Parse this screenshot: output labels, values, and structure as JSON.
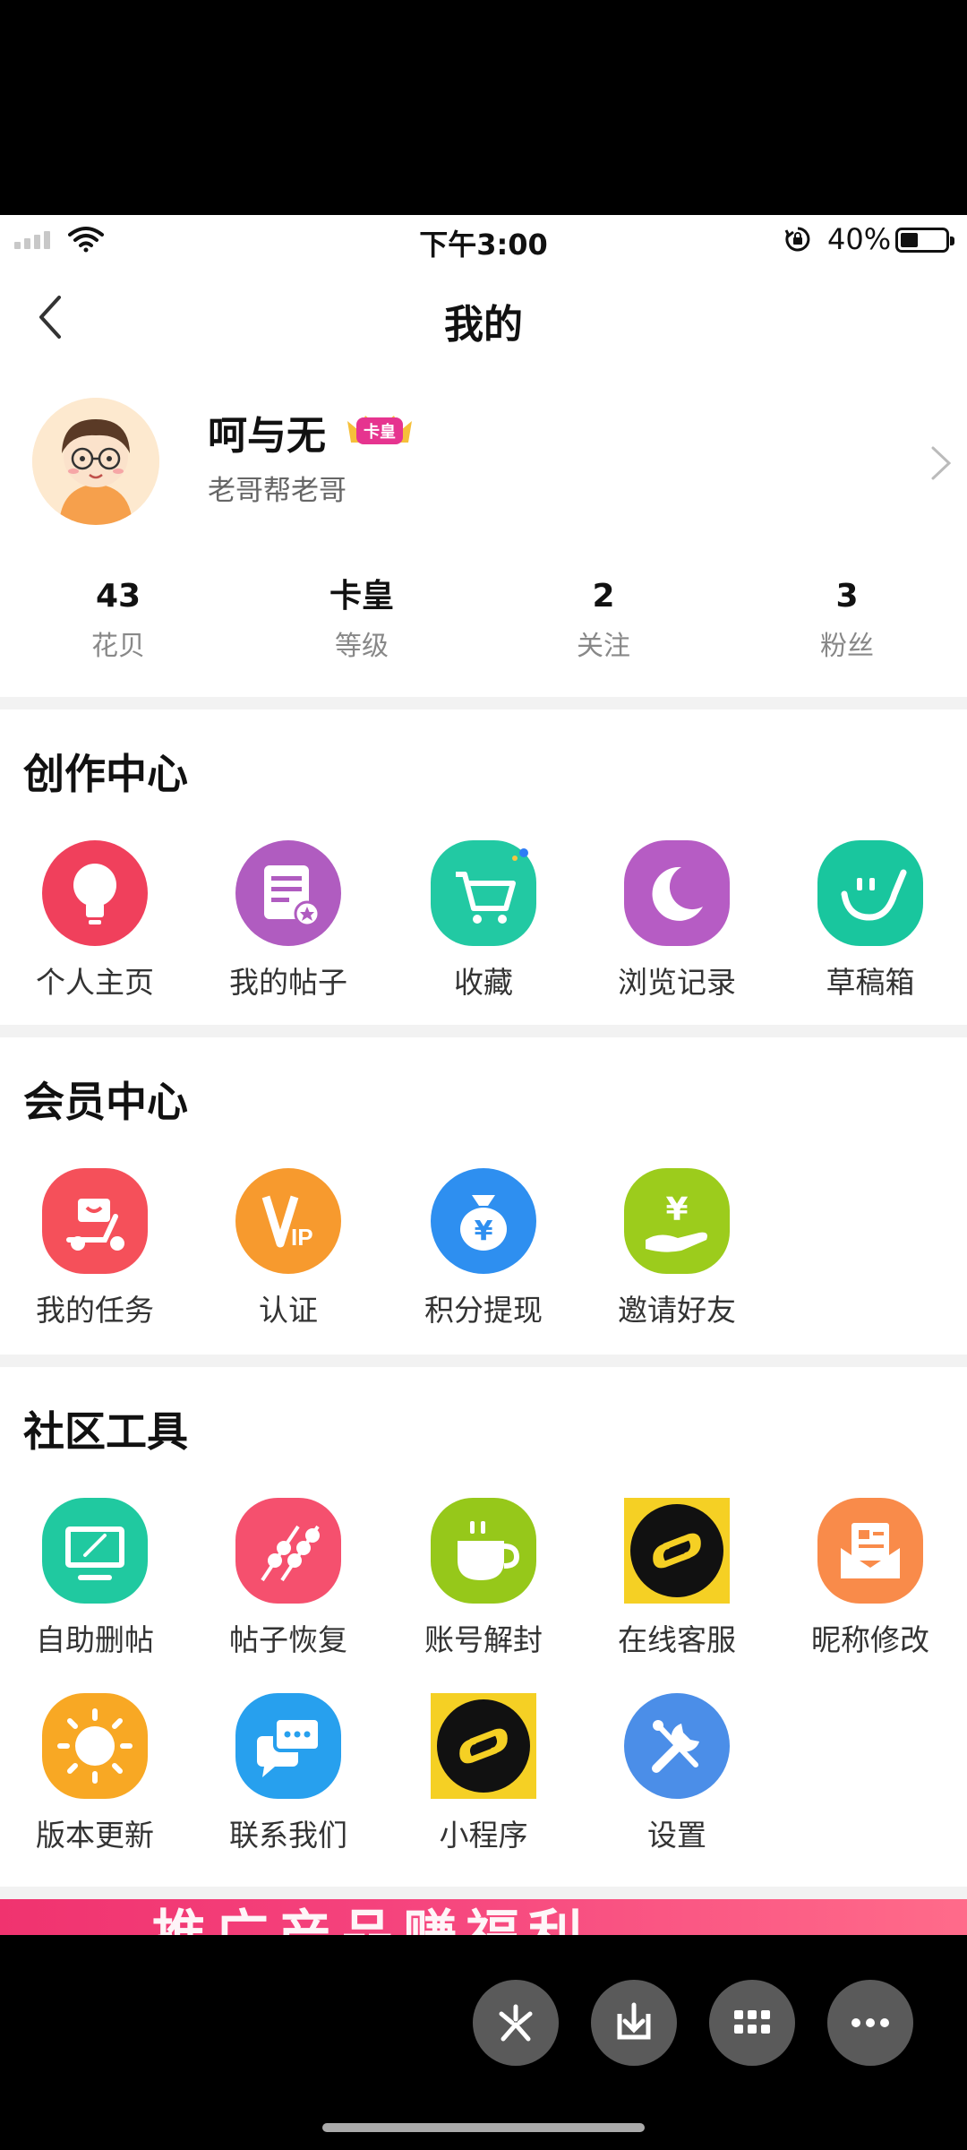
{
  "status_bar": {
    "time": "下午3:00",
    "battery_percent": "40%",
    "battery_level": 0.4
  },
  "nav": {
    "title": "我的"
  },
  "profile": {
    "name": "呵与无",
    "badge": "卡皇",
    "bio": "老哥帮老哥"
  },
  "stats": [
    {
      "value": "43",
      "label": "花贝"
    },
    {
      "value": "卡皇",
      "label": "等级"
    },
    {
      "value": "2",
      "label": "关注"
    },
    {
      "value": "3",
      "label": "粉丝"
    }
  ],
  "creation": {
    "title": "创作中心",
    "items": [
      {
        "label": "个人主页",
        "icon": "lightbulb-icon",
        "color": "#f0405c"
      },
      {
        "label": "我的帖子",
        "icon": "document-icon",
        "color": "#b05cc0"
      },
      {
        "label": "收藏",
        "icon": "cart-icon",
        "color": "#22c9a3"
      },
      {
        "label": "浏览记录",
        "icon": "moon-icon",
        "color": "#b65cc4"
      },
      {
        "label": "草稿箱",
        "icon": "draft-icon",
        "color": "#19c69e"
      }
    ]
  },
  "member": {
    "title": "会员中心",
    "items": [
      {
        "label": "我的任务",
        "icon": "scooter-icon",
        "color": "#f5505a"
      },
      {
        "label": "认证",
        "icon": "vip-icon",
        "color": "#f79a2e"
      },
      {
        "label": "积分提现",
        "icon": "money-bag-icon",
        "color": "#2e8ff0"
      },
      {
        "label": "邀请好友",
        "icon": "yen-hand-icon",
        "color": "#9ccc1c"
      }
    ]
  },
  "tools": {
    "title": "社区工具",
    "items": [
      {
        "label": "自助删帖",
        "icon": "monitor-pen-icon",
        "color": "#20c9a0"
      },
      {
        "label": "帖子恢复",
        "icon": "skewer-icon",
        "color": "#f5506e"
      },
      {
        "label": "账号解封",
        "icon": "cup-icon",
        "color": "#96c81a"
      },
      {
        "label": "在线客服",
        "icon": "mini-program-icon",
        "color": "#f5d024"
      },
      {
        "label": "昵称修改",
        "icon": "mail-icon",
        "color": "#f98b4a"
      },
      {
        "label": "版本更新",
        "icon": "sun-icon",
        "color": "#f8a824"
      },
      {
        "label": "联系我们",
        "icon": "chat-icon",
        "color": "#27a0ee"
      },
      {
        "label": "小程序",
        "icon": "mini-program-icon",
        "color": "#f5d024"
      },
      {
        "label": "设置",
        "icon": "wrench-icon",
        "color": "#4b8ee8"
      }
    ]
  },
  "banner": {
    "text": "推广产品赚福利"
  },
  "floating_buttons": [
    "scissors-icon",
    "download-icon",
    "grid-icon",
    "more-icon"
  ]
}
